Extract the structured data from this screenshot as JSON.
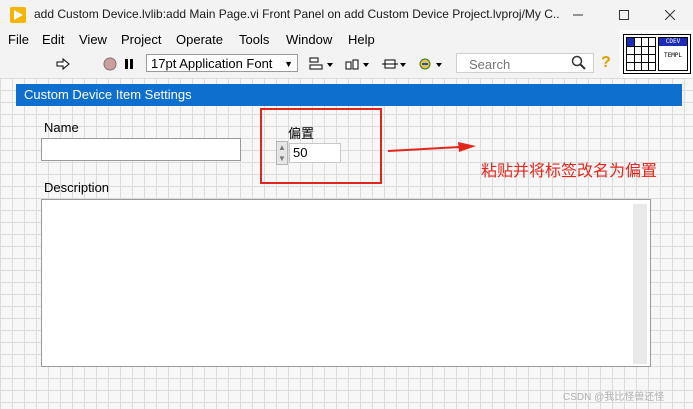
{
  "window": {
    "title": "add Custom Device.lvlib:add Main Page.vi Front Panel on add Custom Device Project.lvproj/My C...",
    "app_icon": "labview-icon"
  },
  "menu": {
    "items": [
      "File",
      "Edit",
      "View",
      "Project",
      "Operate",
      "Tools",
      "Window",
      "Help"
    ]
  },
  "toolbar": {
    "font": "17pt Application Font",
    "search_placeholder": "Search",
    "icons": [
      "run-arrow-icon",
      "abort-icon",
      "pause-icon",
      "align-icon",
      "distribute-icon",
      "resize-icon",
      "reorder-icon",
      "search-icon",
      "help-icon"
    ]
  },
  "vi_icon": {
    "line1": "CDEV",
    "line2": "TEMPL"
  },
  "panel": {
    "header": "Custom Device Item Settings",
    "name_label": "Name",
    "name_value": "",
    "offset_label": "偏置",
    "offset_value": "50",
    "description_label": "Description",
    "description_value": ""
  },
  "annotation": {
    "text": "粘贴并将标签改名为偏置",
    "color": "#e3261c"
  },
  "watermark": "CSDN @我比怪兽还怪"
}
